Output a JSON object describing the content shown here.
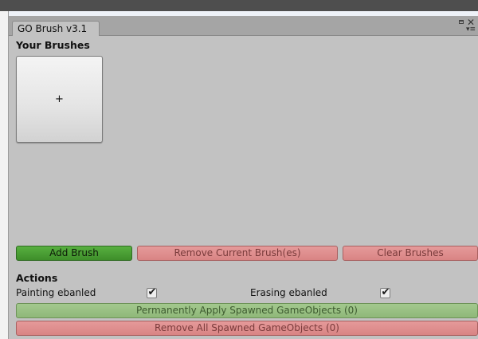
{
  "window": {
    "tab_title": "GO Brush v3.1"
  },
  "brushes": {
    "heading": "Your Brushes",
    "add_slot_symbol": "+"
  },
  "toolbar": {
    "add_brush": "Add Brush",
    "remove_current": "Remove Current Brush(es)",
    "clear_brushes": "Clear Brushes"
  },
  "actions": {
    "heading": "Actions",
    "painting_label": "Painting ebanled",
    "painting_checked": true,
    "erasing_label": "Erasing ebanled",
    "erasing_checked": true,
    "apply_button": "Permanently Apply Spawned GameObjects (0)",
    "remove_all_button": "Remove All Spawned GameObjects (0)"
  },
  "colors": {
    "panel_bg": "#c2c2c2",
    "green_button": "#4a9c34",
    "red_button": "#dd8e8e",
    "light_green_button": "#98c083"
  }
}
